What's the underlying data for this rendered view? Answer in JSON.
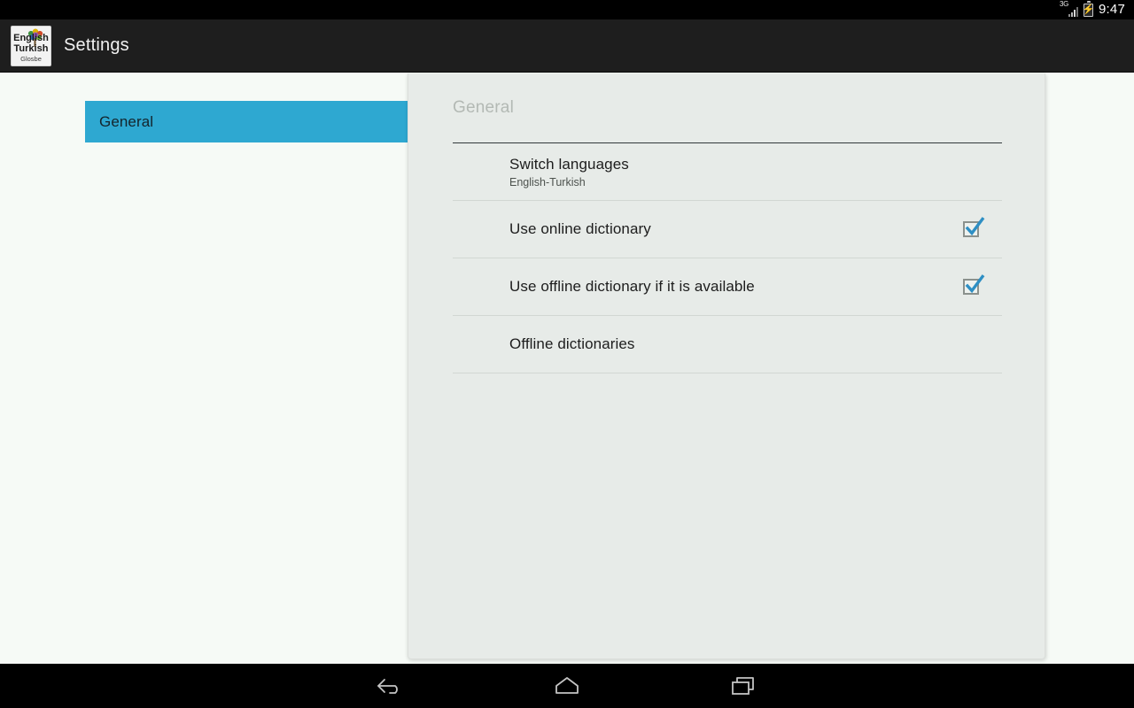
{
  "status_bar": {
    "network_type": "3G",
    "signal_icon": "signal-bars-icon",
    "battery_icon": "battery-charging-icon",
    "time": "9:47"
  },
  "action_bar": {
    "app_icon": "app-logo-icon",
    "app_icon_text": {
      "line1": "English",
      "line2": "Turkish",
      "line3": "Glosbe"
    },
    "title": "Settings"
  },
  "sidebar": {
    "items": [
      {
        "label": "General",
        "selected": true
      }
    ],
    "selected_color": "#2ea8d1"
  },
  "panel": {
    "title": "General",
    "preferences": [
      {
        "title": "Switch languages",
        "summary": "English-Turkish",
        "has_checkbox": false,
        "checked": false
      },
      {
        "title": "Use online dictionary",
        "summary": "",
        "has_checkbox": true,
        "checked": true
      },
      {
        "title": "Use offline dictionary if it is available",
        "summary": "",
        "has_checkbox": true,
        "checked": true
      },
      {
        "title": "Offline dictionaries",
        "summary": "",
        "has_checkbox": false,
        "checked": false
      }
    ],
    "checkbox_color": "#2e8fc4"
  },
  "nav_bar": {
    "buttons": [
      {
        "name": "back-icon",
        "label": "Back"
      },
      {
        "name": "home-icon",
        "label": "Home"
      },
      {
        "name": "recents-icon",
        "label": "Recent apps"
      }
    ]
  }
}
